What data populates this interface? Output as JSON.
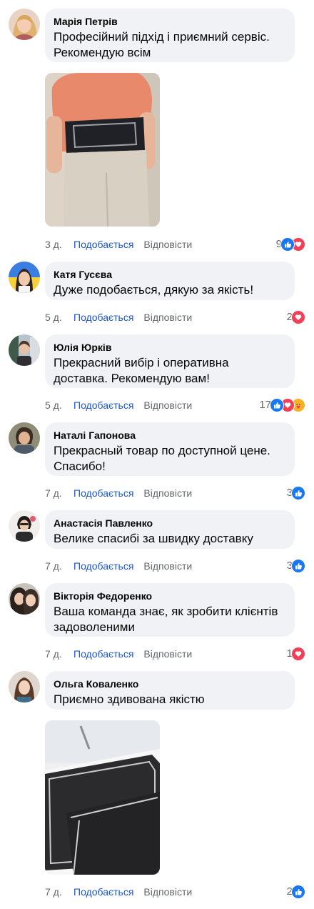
{
  "ui": {
    "like_label": "Подобається",
    "reply_label": "Відповісти"
  },
  "colors": {
    "bubble": "#f0f2f5",
    "like_link": "#1b58c9",
    "meta_text": "#65676b",
    "like_reaction": "#1877f2",
    "love_reaction": "#f33e58",
    "care_reaction": "#f7b125"
  },
  "comments": [
    {
      "author": "Марія Петрів",
      "text": "Професійний підхід і приємний сервіс. Рекомендую всім",
      "time": "3 д.",
      "reaction_count": "9",
      "reactions": [
        "like-icon",
        "love-icon"
      ],
      "has_photo": true
    },
    {
      "author": "Катя Гусєва",
      "text": "Дуже подобається, дякую за якість!",
      "time": "5 д.",
      "reaction_count": "2",
      "reactions": [
        "love-icon"
      ]
    },
    {
      "author": "Юлія Юрків",
      "text": "Прекрасний вибір і оперативна доставка. Рекомендую вам!",
      "time": "5 д.",
      "reaction_count": "17",
      "reactions": [
        "like-icon",
        "love-icon",
        "care-icon"
      ]
    },
    {
      "author": "Наталі Гапонова",
      "text": "Прекрасный товар по доступной цене. Спасибо!",
      "time": "7 д.",
      "reaction_count": "3",
      "reactions": [
        "like-icon"
      ]
    },
    {
      "author": "Анастасія Павленко",
      "text": "Велике спасибі за швидку доставку",
      "time": "7 д.",
      "reaction_count": "3",
      "reactions": [
        "like-icon"
      ]
    },
    {
      "author": "Вікторія Федоренко",
      "text": "Ваша команда знає, як зробити клієнтів задоволеними",
      "time": "7 д.",
      "reaction_count": "1",
      "reactions": [
        "love-icon"
      ]
    },
    {
      "author": "Ольга Коваленко",
      "text": "Приємно здивована якістю",
      "time": "7 д.",
      "reaction_count": "2",
      "reactions": [
        "like-icon"
      ],
      "has_photo": true
    }
  ]
}
